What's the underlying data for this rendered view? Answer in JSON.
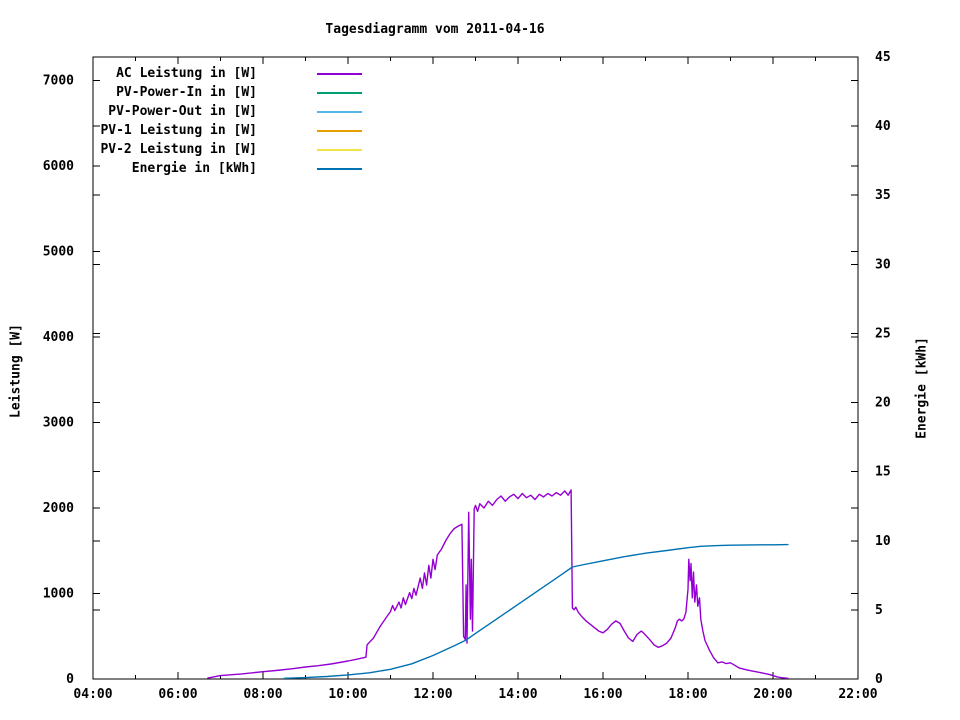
{
  "chart_data": {
    "type": "line",
    "title": "Tagesdiagramm vom 2011-04-16",
    "background_color": "#ffffff",
    "axis_color": "#000000",
    "grid": false,
    "legend_position": "top-left-inside",
    "x_axis": {
      "unit": "time of day",
      "min": 4,
      "max": 22,
      "major_ticks": [
        4,
        6,
        8,
        10,
        12,
        14,
        16,
        18,
        20,
        22
      ],
      "major_tick_labels": [
        "04:00",
        "06:00",
        "08:00",
        "10:00",
        "12:00",
        "14:00",
        "16:00",
        "18:00",
        "20:00",
        "22:00"
      ],
      "minor_ticks": [
        5,
        7,
        9,
        11,
        13,
        15,
        17,
        19,
        21
      ]
    },
    "y_axis_left": {
      "label": "Leistung [W]",
      "min": 0,
      "max": 7275,
      "ticks": [
        0,
        1000,
        2000,
        3000,
        4000,
        5000,
        6000,
        7000
      ],
      "tick_labels": [
        "0",
        "1000",
        "2000",
        "3000",
        "4000",
        "5000",
        "6000",
        "7000"
      ]
    },
    "y_axis_right": {
      "label": "Energie [kWh]",
      "min": 0,
      "max": 45,
      "ticks": [
        0,
        5,
        10,
        15,
        20,
        25,
        30,
        35,
        40,
        45
      ],
      "tick_labels": [
        "0",
        "5",
        "10",
        "15",
        "20",
        "25",
        "30",
        "35",
        "40",
        "45"
      ]
    },
    "series": [
      {
        "label": "AC Leistung in [W]",
        "color": "#9400d3",
        "axis": "left",
        "points": [
          [
            6.7,
            10
          ],
          [
            7.0,
            40
          ],
          [
            7.5,
            60
          ],
          [
            8.0,
            85
          ],
          [
            8.3,
            100
          ],
          [
            8.7,
            120
          ],
          [
            9.0,
            140
          ],
          [
            9.3,
            155
          ],
          [
            9.6,
            175
          ],
          [
            10.0,
            210
          ],
          [
            10.2,
            230
          ],
          [
            10.42,
            255
          ],
          [
            10.45,
            400
          ],
          [
            10.6,
            480
          ],
          [
            10.75,
            610
          ],
          [
            10.9,
            720
          ],
          [
            11.0,
            790
          ],
          [
            11.05,
            860
          ],
          [
            11.1,
            800
          ],
          [
            11.2,
            900
          ],
          [
            11.25,
            830
          ],
          [
            11.3,
            950
          ],
          [
            11.35,
            870
          ],
          [
            11.45,
            1010
          ],
          [
            11.5,
            940
          ],
          [
            11.55,
            1060
          ],
          [
            11.6,
            980
          ],
          [
            11.7,
            1180
          ],
          [
            11.75,
            1060
          ],
          [
            11.8,
            1240
          ],
          [
            11.85,
            1100
          ],
          [
            11.9,
            1330
          ],
          [
            11.95,
            1180
          ],
          [
            12.0,
            1400
          ],
          [
            12.05,
            1280
          ],
          [
            12.1,
            1450
          ],
          [
            12.2,
            1520
          ],
          [
            12.3,
            1620
          ],
          [
            12.4,
            1700
          ],
          [
            12.5,
            1760
          ],
          [
            12.6,
            1790
          ],
          [
            12.68,
            1810
          ],
          [
            12.72,
            500
          ],
          [
            12.76,
            460
          ],
          [
            12.78,
            1100
          ],
          [
            12.8,
            420
          ],
          [
            12.84,
            1950
          ],
          [
            12.88,
            700
          ],
          [
            12.9,
            1400
          ],
          [
            12.93,
            560
          ],
          [
            12.97,
            1990
          ],
          [
            13.0,
            2030
          ],
          [
            13.05,
            1960
          ],
          [
            13.1,
            2050
          ],
          [
            13.2,
            2000
          ],
          [
            13.3,
            2080
          ],
          [
            13.4,
            2030
          ],
          [
            13.5,
            2100
          ],
          [
            13.6,
            2140
          ],
          [
            13.7,
            2080
          ],
          [
            13.8,
            2130
          ],
          [
            13.9,
            2160
          ],
          [
            14.0,
            2110
          ],
          [
            14.1,
            2170
          ],
          [
            14.2,
            2120
          ],
          [
            14.3,
            2150
          ],
          [
            14.4,
            2100
          ],
          [
            14.5,
            2160
          ],
          [
            14.6,
            2130
          ],
          [
            14.7,
            2170
          ],
          [
            14.8,
            2140
          ],
          [
            14.9,
            2180
          ],
          [
            15.0,
            2150
          ],
          [
            15.1,
            2200
          ],
          [
            15.18,
            2150
          ],
          [
            15.25,
            2210
          ],
          [
            15.28,
            830
          ],
          [
            15.32,
            810
          ],
          [
            15.36,
            840
          ],
          [
            15.42,
            780
          ],
          [
            15.5,
            730
          ],
          [
            15.6,
            680
          ],
          [
            15.7,
            640
          ],
          [
            15.8,
            600
          ],
          [
            15.9,
            560
          ],
          [
            16.0,
            540
          ],
          [
            16.1,
            580
          ],
          [
            16.2,
            640
          ],
          [
            16.3,
            680
          ],
          [
            16.4,
            650
          ],
          [
            16.5,
            560
          ],
          [
            16.6,
            480
          ],
          [
            16.7,
            440
          ],
          [
            16.8,
            520
          ],
          [
            16.9,
            560
          ],
          [
            16.95,
            540
          ],
          [
            17.1,
            460
          ],
          [
            17.2,
            400
          ],
          [
            17.3,
            370
          ],
          [
            17.4,
            390
          ],
          [
            17.5,
            420
          ],
          [
            17.6,
            480
          ],
          [
            17.7,
            600
          ],
          [
            17.75,
            680
          ],
          [
            17.8,
            700
          ],
          [
            17.85,
            680
          ],
          [
            17.9,
            700
          ],
          [
            17.95,
            780
          ],
          [
            18.0,
            1050
          ],
          [
            18.02,
            1400
          ],
          [
            18.05,
            1150
          ],
          [
            18.07,
            1350
          ],
          [
            18.1,
            950
          ],
          [
            18.13,
            1250
          ],
          [
            18.16,
            900
          ],
          [
            18.2,
            1100
          ],
          [
            18.23,
            850
          ],
          [
            18.27,
            950
          ],
          [
            18.3,
            700
          ],
          [
            18.35,
            560
          ],
          [
            18.4,
            450
          ],
          [
            18.5,
            340
          ],
          [
            18.6,
            250
          ],
          [
            18.7,
            190
          ],
          [
            18.8,
            200
          ],
          [
            18.9,
            180
          ],
          [
            19.0,
            190
          ],
          [
            19.1,
            160
          ],
          [
            19.2,
            130
          ],
          [
            19.35,
            110
          ],
          [
            19.5,
            95
          ],
          [
            19.7,
            75
          ],
          [
            19.9,
            55
          ],
          [
            20.0,
            40
          ],
          [
            20.1,
            25
          ],
          [
            20.2,
            15
          ],
          [
            20.35,
            8
          ]
        ]
      },
      {
        "label": "PV-Power-In in [W]",
        "color": "#009e73",
        "axis": "left",
        "points": []
      },
      {
        "label": "PV-Power-Out in [W]",
        "color": "#56b4e9",
        "axis": "left",
        "points": []
      },
      {
        "label": "PV-1 Leistung in [W]",
        "color": "#e69f00",
        "axis": "left",
        "points": []
      },
      {
        "label": "PV-2 Leistung in [W]",
        "color": "#f0e442",
        "axis": "left",
        "points": []
      },
      {
        "label": "Energie in [kWh]",
        "color": "#0072b2",
        "axis": "right",
        "points": [
          [
            8.5,
            0.05
          ],
          [
            9.0,
            0.1
          ],
          [
            9.5,
            0.18
          ],
          [
            10.0,
            0.3
          ],
          [
            10.5,
            0.45
          ],
          [
            11.0,
            0.7
          ],
          [
            11.5,
            1.1
          ],
          [
            12.0,
            1.7
          ],
          [
            12.5,
            2.4
          ],
          [
            12.77,
            2.8
          ],
          [
            13.0,
            3.3
          ],
          [
            13.5,
            4.35
          ],
          [
            14.0,
            5.4
          ],
          [
            14.5,
            6.45
          ],
          [
            15.0,
            7.5
          ],
          [
            15.28,
            8.1
          ],
          [
            15.5,
            8.25
          ],
          [
            16.0,
            8.55
          ],
          [
            16.5,
            8.85
          ],
          [
            17.0,
            9.1
          ],
          [
            17.5,
            9.3
          ],
          [
            18.0,
            9.5
          ],
          [
            18.3,
            9.6
          ],
          [
            18.7,
            9.65
          ],
          [
            19.0,
            9.68
          ],
          [
            19.5,
            9.7
          ],
          [
            20.0,
            9.71
          ],
          [
            20.35,
            9.72
          ]
        ]
      }
    ]
  }
}
